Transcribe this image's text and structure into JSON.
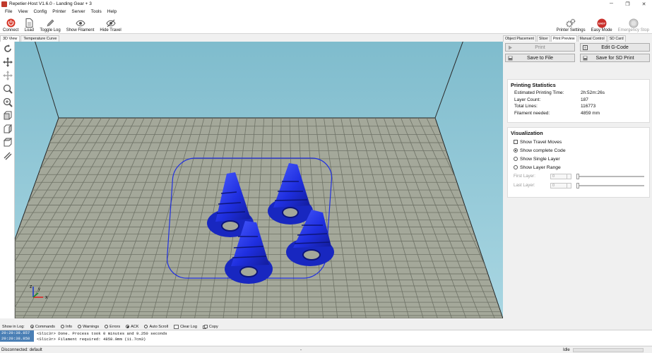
{
  "window": {
    "title": "Repetier-Host V1.6.0 - Landing Gear + 3"
  },
  "menu": [
    "File",
    "View",
    "Config",
    "Printer",
    "Server",
    "Tools",
    "Help"
  ],
  "toolbar": {
    "connect": "Connect",
    "load": "Load",
    "toggle_log": "Toggle Log",
    "show_filament": "Show Filament",
    "hide_travel": "Hide Travel",
    "printer_settings": "Printer Settings",
    "easy_mode": "Easy Mode",
    "easy_badge": "EASY",
    "emergency_stop": "Emergency Stop"
  },
  "view_tabs": [
    "3D View",
    "Temperature Curve"
  ],
  "right_tabs": [
    "Object Placement",
    "Slicer",
    "Print Preview",
    "Manual Control",
    "SD Card"
  ],
  "preview": {
    "print_label": "Print",
    "edit_gcode_label": "Edit G-Code",
    "save_file_label": "Save to File",
    "save_sd_label": "Save for SD Print",
    "stats_title": "Printing Statistics",
    "stats": [
      {
        "label": "Estimated Printing Time:",
        "value": "2h:52m:26s"
      },
      {
        "label": "Layer Count:",
        "value": "187"
      },
      {
        "label": "Total Lines:",
        "value": "116773"
      },
      {
        "label": "Filament needed:",
        "value": "4859 mm"
      }
    ],
    "vis_title": "Visualization",
    "show_travel": "Show Travel Moves",
    "opt_complete": "Show complete Code",
    "opt_single": "Show Single Layer",
    "opt_range": "Show Layer Range",
    "first_layer_label": "First Layer:",
    "first_layer_value": "0",
    "last_layer_label": "Last Layer:",
    "last_layer_value": "0"
  },
  "log": {
    "show_in_log": "Show in Log:",
    "filters": [
      "Commands",
      "Info",
      "Warnings",
      "Errors",
      "ACK",
      "Auto Scroll"
    ],
    "clear_log": "Clear Log",
    "copy": "Copy",
    "lines": [
      {
        "time": "20:20:38.857",
        "msg": "<Slic3r> Done. Process took 0 minutes and 9.250 seconds"
      },
      {
        "time": "20:20:38.858",
        "msg": "<Slic3r> Filament required: 4858.9mm (11.7cm3)"
      }
    ]
  },
  "status": {
    "connection": "Disconnected: default",
    "dash": "-",
    "state": "Idle"
  },
  "axes": {
    "x": "x",
    "y": "y",
    "z": "z"
  },
  "colors": {
    "part": "#2030e0",
    "bed": "#a4a89a",
    "sky": "#80bfcf"
  }
}
